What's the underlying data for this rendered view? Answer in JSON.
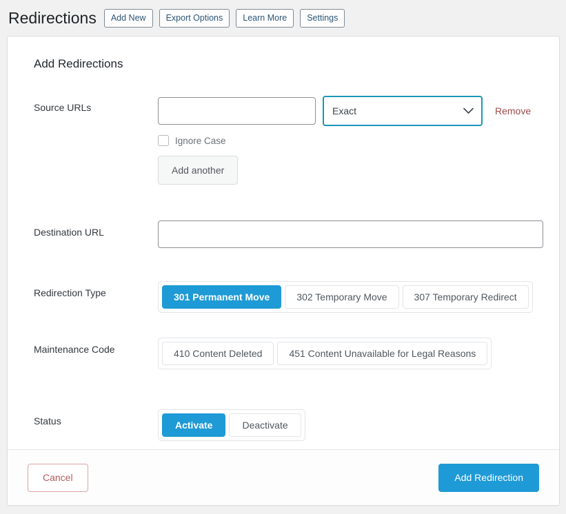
{
  "header": {
    "title": "Redirections",
    "buttons": [
      {
        "label": "Add New"
      },
      {
        "label": "Export Options"
      },
      {
        "label": "Learn More"
      },
      {
        "label": "Settings"
      }
    ]
  },
  "card": {
    "heading": "Add Redirections",
    "source": {
      "label": "Source URLs",
      "input_value": "",
      "input_placeholder": "",
      "match_type_value": "Exact",
      "match_type_options": [
        "Exact"
      ],
      "remove_label": "Remove",
      "ignore_case_label": "Ignore Case",
      "ignore_case_checked": false,
      "add_another_label": "Add another"
    },
    "destination": {
      "label": "Destination URL",
      "input_value": "",
      "input_placeholder": ""
    },
    "redirection_type": {
      "label": "Redirection Type",
      "options": [
        {
          "label": "301 Permanent Move",
          "selected": true
        },
        {
          "label": "302 Temporary Move",
          "selected": false
        },
        {
          "label": "307 Temporary Redirect",
          "selected": false
        }
      ]
    },
    "maintenance_code": {
      "label": "Maintenance Code",
      "options": [
        {
          "label": "410 Content Deleted",
          "selected": false
        },
        {
          "label": "451 Content Unavailable for Legal Reasons",
          "selected": false
        }
      ]
    },
    "status": {
      "label": "Status",
      "options": [
        {
          "label": "Activate",
          "selected": true
        },
        {
          "label": "Deactivate",
          "selected": false
        }
      ]
    },
    "footer": {
      "cancel_label": "Cancel",
      "submit_label": "Add Redirection"
    }
  },
  "colors": {
    "accent_blue": "#1e9ad6",
    "focus_teal": "#1a96b8",
    "danger_red": "#9b4a4a",
    "page_bg": "#f1f1f1"
  },
  "icons": {
    "chevron_down": "chevron-down-icon",
    "checkbox": "checkbox-icon"
  }
}
